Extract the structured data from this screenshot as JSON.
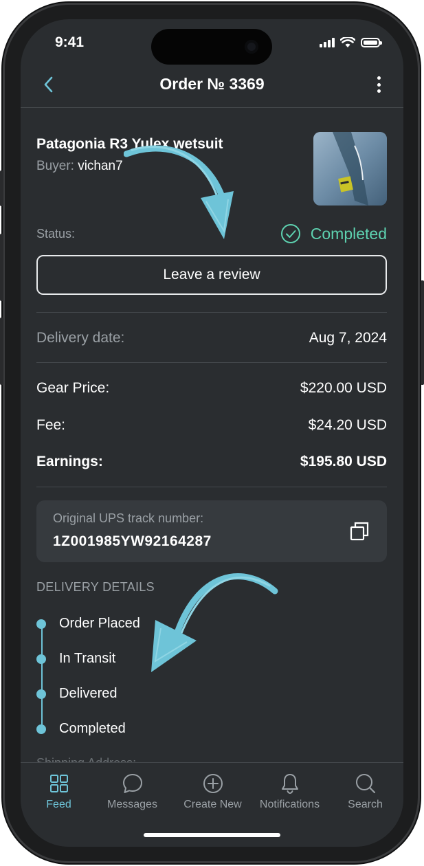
{
  "status_bar": {
    "time": "9:41"
  },
  "nav": {
    "title": "Order № 3369",
    "back_icon": "chevron-left-icon",
    "more_icon": "more-vertical-icon"
  },
  "order": {
    "product_title": "Patagonia R3 Yulex wetsuit",
    "buyer_label": "Buyer:",
    "buyer_name": "vichan7",
    "status_label": "Status:",
    "status_value": "Completed",
    "review_button": "Leave a review",
    "delivery_date_label": "Delivery date:",
    "delivery_date_value": "Aug 7, 2024",
    "gear_price_label": "Gear Price:",
    "gear_price_value": "$220.00 USD",
    "fee_label": "Fee:",
    "fee_value": "$24.20 USD",
    "earnings_label": "Earnings:",
    "earnings_value": "$195.80 USD"
  },
  "tracking": {
    "label": "Original UPS track number:",
    "number": "1Z001985YW92164287"
  },
  "delivery_details": {
    "heading": "DELIVERY DETAILS",
    "steps": [
      "Order Placed",
      "In Transit",
      "Delivered",
      "Completed"
    ]
  },
  "shipping": {
    "label": "Shipping Address:"
  },
  "tabs": [
    {
      "label": "Feed",
      "icon": "grid-icon",
      "active": true
    },
    {
      "label": "Messages",
      "icon": "chat-bubble-icon",
      "active": false
    },
    {
      "label": "Create New",
      "icon": "plus-circle-icon",
      "active": false
    },
    {
      "label": "Notifications",
      "icon": "bell-icon",
      "active": false
    },
    {
      "label": "Search",
      "icon": "search-icon",
      "active": false
    }
  ],
  "colors": {
    "background": "#2a2d30",
    "accent": "#6ec4d8",
    "success": "#5ed3b1",
    "muted": "#9aa0a5"
  }
}
